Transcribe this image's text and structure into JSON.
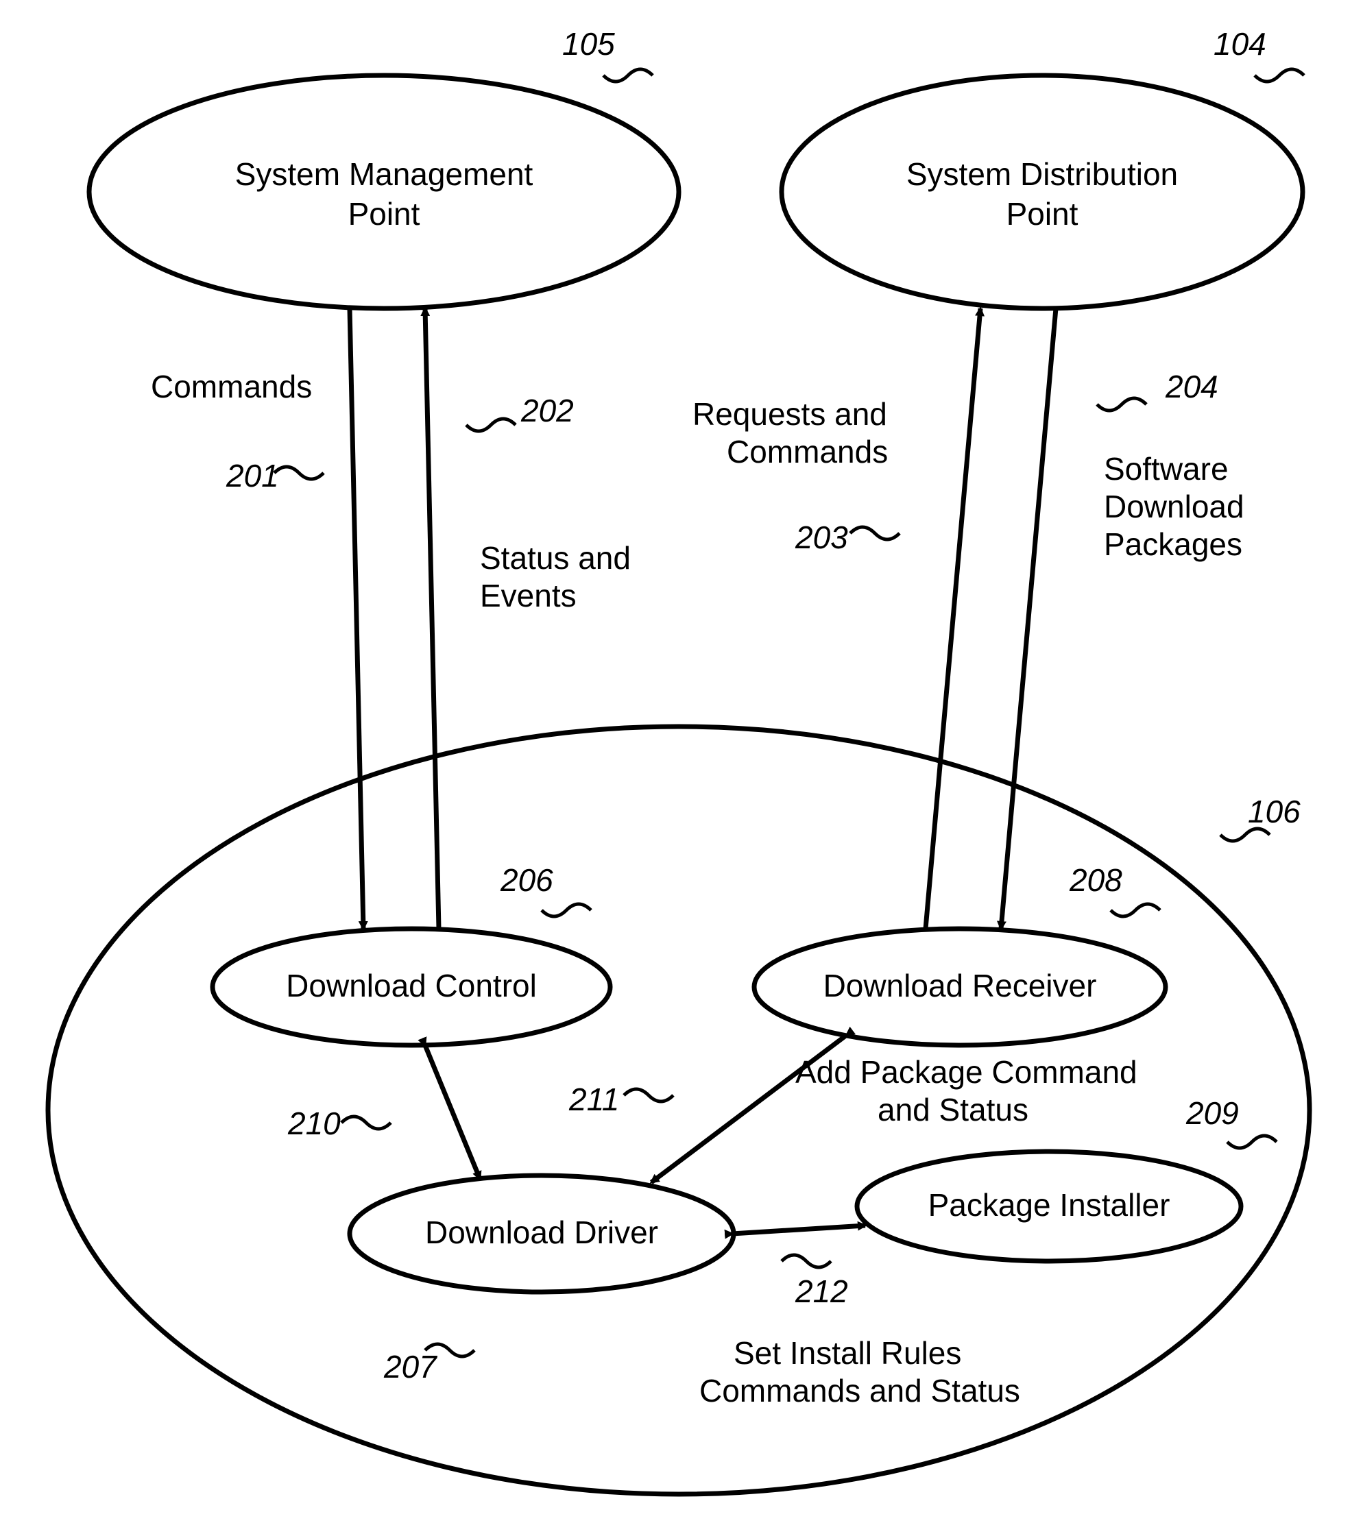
{
  "nodes": {
    "smp": {
      "line1": "System Management",
      "line2": "Point",
      "ref": "105"
    },
    "sdp": {
      "line1": "System Distribution",
      "line2": "Point",
      "ref": "104"
    },
    "dc": {
      "text": "Download Control",
      "ref": "206"
    },
    "dr": {
      "text": "Download Receiver",
      "ref": "208"
    },
    "dd": {
      "text": "Download Driver",
      "ref": "207"
    },
    "pi": {
      "text": "Package Installer",
      "ref": "209"
    },
    "container": {
      "ref": "106"
    }
  },
  "edges": {
    "commands": {
      "text": "Commands",
      "ref": "201"
    },
    "status_events": {
      "line1": "Status and",
      "line2": "Events",
      "ref": "202"
    },
    "req_cmds": {
      "line1": "Requests and",
      "line2": "Commands",
      "ref": "203"
    },
    "sw_pkgs": {
      "line1": "Software",
      "line2": "Download",
      "line3": "Packages",
      "ref": "204"
    },
    "dc_dd": {
      "ref": "210"
    },
    "dr_dd": {
      "ref": "211"
    },
    "add_pkg": {
      "line1": "Add Package Command",
      "line2": "and Status"
    },
    "dd_pi": {
      "ref": "212"
    },
    "install_rules": {
      "line1": "Set Install Rules",
      "line2": "Commands and Status"
    }
  }
}
